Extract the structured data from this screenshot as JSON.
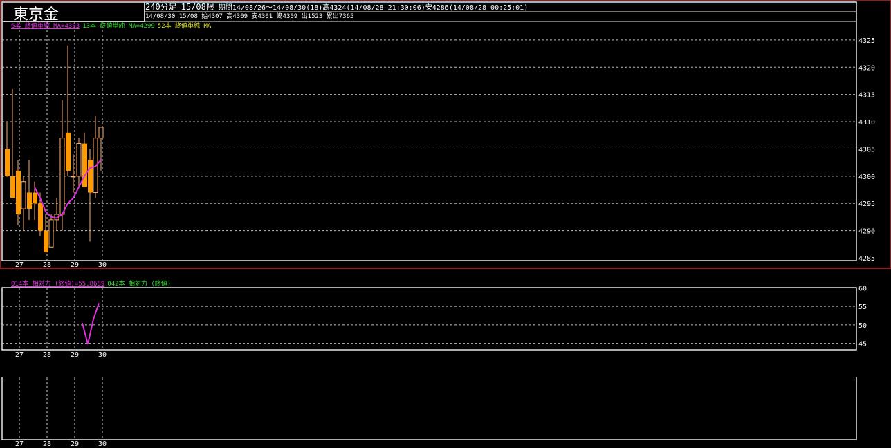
{
  "header": {
    "title": "東京金",
    "timeframe": "240分足",
    "contract": "15/08限",
    "period_info": "期間14/08/26～14/08/30(18)高4324(14/08/28 21:30:06)安4286(14/08/28 00:25:01)",
    "bar_info": "14/08/30 15/08 始4307 高4309 安4301 終4309 出1523 累出7365"
  },
  "legends": {
    "main": [
      {
        "text": "6本 終値単純 MA=4303",
        "color": "#e030e0"
      },
      {
        "text": "13本 終値単純 MA=4299",
        "color": "#30e030"
      },
      {
        "text": "52本 終値単純 MA",
        "color": "#e8e830"
      }
    ],
    "osc": [
      {
        "text": "014本 相対力 (終値)=55.8689",
        "color": "#e030e0"
      },
      {
        "text": "042本 相対力 (終値)",
        "color": "#30e030"
      }
    ]
  },
  "x_axis_days": [
    "27",
    "28",
    "29",
    "30"
  ],
  "chart_data": [
    {
      "type": "candlestick",
      "title": "東京金",
      "ylim": [
        4285,
        4326
      ],
      "yticks": [
        4325,
        4320,
        4315,
        4310,
        4305,
        4300,
        4295,
        4290,
        4285
      ],
      "grid": true,
      "up_color": "#ffb070",
      "down_color": "#ff9900",
      "candles": [
        {
          "o": 4305,
          "h": 4310,
          "l": 4300,
          "c": 4300
        },
        {
          "o": 4300,
          "h": 4316,
          "l": 4296,
          "c": 4296
        },
        {
          "o": 4301,
          "h": 4303,
          "l": 4291,
          "c": 4293
        },
        {
          "o": 4294,
          "h": 4300,
          "l": 4290,
          "c": 4299
        },
        {
          "o": 4297,
          "h": 4303,
          "l": 4292,
          "c": 4294
        },
        {
          "o": 4297,
          "h": 4299,
          "l": 4292,
          "c": 4295
        },
        {
          "o": 4295,
          "h": 4297,
          "l": 4289,
          "c": 4290
        },
        {
          "o": 4290,
          "h": 4293,
          "l": 4286,
          "c": 4286
        },
        {
          "o": 4287,
          "h": 4293,
          "l": 4287,
          "c": 4292
        },
        {
          "o": 4292,
          "h": 4296,
          "l": 4290,
          "c": 4293
        },
        {
          "o": 4293,
          "h": 4314,
          "l": 4290,
          "c": 4307
        },
        {
          "o": 4308,
          "h": 4324,
          "l": 4300,
          "c": 4301
        },
        {
          "o": 4300,
          "h": 4304,
          "l": 4297,
          "c": 4300
        },
        {
          "o": 4300,
          "h": 4307,
          "l": 4298,
          "c": 4306
        },
        {
          "o": 4306,
          "h": 4308,
          "l": 4298,
          "c": 4298
        },
        {
          "o": 4303,
          "h": 4305,
          "l": 4288,
          "c": 4297
        },
        {
          "o": 4297,
          "h": 4311,
          "l": 4296,
          "c": 4307
        },
        {
          "o": 4307,
          "h": 4309,
          "l": 4301,
          "c": 4309
        }
      ],
      "ma": {
        "name": "6本 終値単純 MA",
        "color": "#e030e0",
        "start_index": 5,
        "values": [
          4298,
          4296,
          4293.5,
          4292.5,
          4292.3,
          4293,
          4295,
          4296,
          4298,
          4300,
          4301.5,
          4301.8,
          4303
        ]
      }
    },
    {
      "type": "line",
      "title": "014本 相対力 (終値)",
      "ylim": [
        44,
        61
      ],
      "yticks": [
        60,
        55,
        50,
        45
      ],
      "grid": true,
      "series": [
        {
          "name": "014本 相対力 (終値)",
          "color": "#e030e0",
          "start_index": 14,
          "values": [
            50.5,
            44.8,
            51.5,
            55.87
          ]
        }
      ]
    }
  ]
}
